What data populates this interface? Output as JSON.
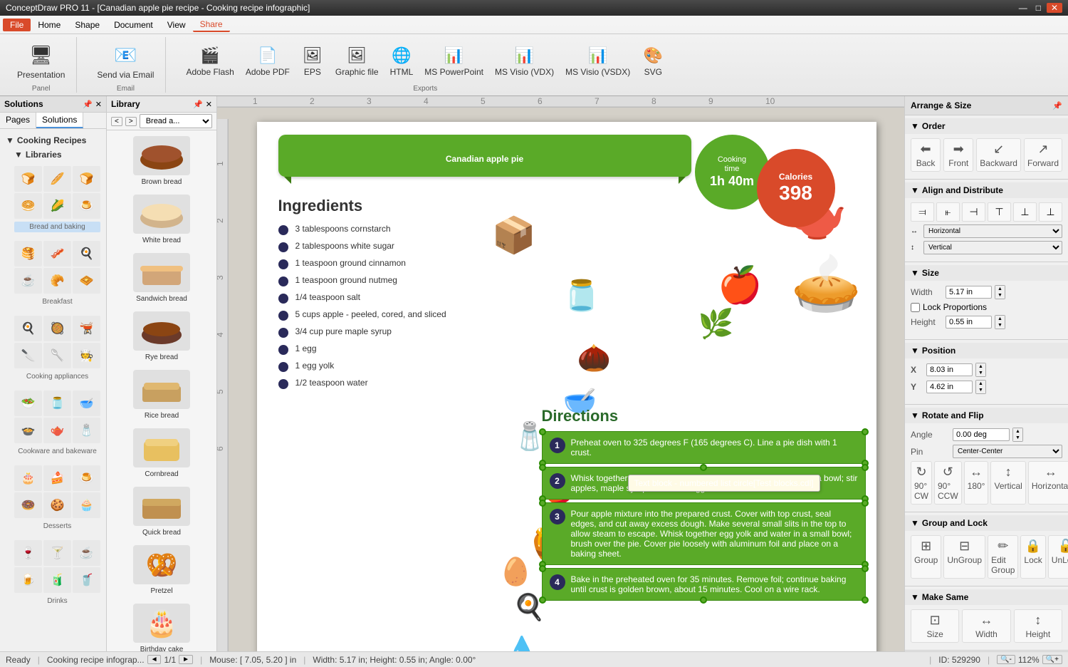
{
  "titlebar": {
    "title": "ConceptDraw PRO 11 - [Canadian apple pie recipe - Cooking recipe infographic]",
    "controls": [
      "—",
      "□",
      "✕"
    ]
  },
  "menubar": {
    "items": [
      "File",
      "Home",
      "Shape",
      "Document",
      "View",
      "Share"
    ]
  },
  "ribbon": {
    "groups": [
      {
        "label": "Panel",
        "buttons": [
          {
            "icon": "🖥",
            "label": "Presentation"
          }
        ]
      },
      {
        "label": "Email",
        "buttons": [
          {
            "icon": "📧",
            "label": "Send via\nEmail"
          }
        ]
      },
      {
        "label": "Exports",
        "buttons": [
          {
            "icon": "🎬",
            "label": "Adobe\nFlash"
          },
          {
            "icon": "📄",
            "label": "Adobe\nPDF"
          },
          {
            "icon": "🖼",
            "label": "EPS"
          },
          {
            "icon": "🖼",
            "label": "Graphic\nfile"
          },
          {
            "icon": "🌐",
            "label": "HTML"
          },
          {
            "icon": "📊",
            "label": "MS\nPowerPoint"
          },
          {
            "icon": "📊",
            "label": "MS Visio\n(VDX)"
          },
          {
            "icon": "📊",
            "label": "MS Visio\n(VSDX)"
          },
          {
            "icon": "🎨",
            "label": "SVG"
          }
        ]
      }
    ]
  },
  "solutions": {
    "title": "Solutions",
    "tabs": [
      "Pages",
      "Solutions"
    ],
    "sections": [
      {
        "name": "Cooking Recipes",
        "subsections": [
          {
            "name": "Libraries",
            "items": [
              "Bread and baking",
              "Breakfast",
              "Cooking appliances",
              "Cookware and bakeware",
              "Desserts",
              "Drinks"
            ]
          }
        ]
      }
    ]
  },
  "library": {
    "title": "Library",
    "nav": [
      "<",
      ">"
    ],
    "dropdown": "Bread a...",
    "items": [
      {
        "emoji": "🍞",
        "label": "Brown bread"
      },
      {
        "emoji": "🥖",
        "label": "White bread"
      },
      {
        "emoji": "🍞",
        "label": "Sandwich bread"
      },
      {
        "emoji": "🥯",
        "label": "Rye bread"
      },
      {
        "emoji": "🌽",
        "label": "Rice bread"
      },
      {
        "emoji": "🍮",
        "label": "Cornbread"
      },
      {
        "emoji": "🥨",
        "label": "Quick bread"
      },
      {
        "emoji": "🥨",
        "label": "Pretzel"
      },
      {
        "emoji": "🎂",
        "label": "Birthday cake"
      }
    ]
  },
  "canvas": {
    "title": "Canadian apple pie",
    "cooking_time": {
      "label": "Cooking\ntime",
      "value": "1h 40m"
    },
    "calories": {
      "label": "Calories",
      "value": "398"
    },
    "ingredients": {
      "title": "Ingredients",
      "items": [
        "3 tablespoons cornstarch",
        "2 tablespoons white sugar",
        "1 teaspoon ground cinnamon",
        "1 teaspoon ground nutmeg",
        "1/4 teaspoon salt",
        "5 cups apple - peeled, cored, and sliced",
        "3/4 cup pure maple syrup",
        "1 egg",
        "1 egg yolk",
        "1/2 teaspoon water"
      ]
    },
    "directions": {
      "title": "Directions",
      "items": [
        "Preheat oven to 325 degrees F (165 degrees C). Line a pie dish with 1 crust.",
        "Whisk together cornstarch, sugar, cinnamon, nutmeg, and salt in a bowl; stir apples, maple syrup and whole egg into the mixture.",
        "Pour apple mixture into the prepared crust. Cover with top crust, seal edges, and cut away excess dough. Make several small slits in the top to allow steam to escape. Whisk together egg yolk and water in a small bowl; brush over the pie. Cover pie loosely with aluminum foil and place on a baking sheet.",
        "Bake in the preheated oven for 35 minutes. Remove foil; continue baking until crust is golden brown, about 15 minutes. Cool on a wire rack."
      ]
    }
  },
  "arrange_size": {
    "title": "Arrange & Size",
    "order": {
      "label": "Order",
      "buttons": [
        "Back",
        "Front",
        "Backward",
        "Forward"
      ]
    },
    "align": {
      "label": "Align and Distribute",
      "buttons": [
        "Left",
        "Center",
        "Right",
        "Top",
        "Middle",
        "Bottom"
      ],
      "h_label": "Horizontal",
      "v_label": "Vertical"
    },
    "size": {
      "label": "Size",
      "width": {
        "label": "Width",
        "value": "5.17 in"
      },
      "height": {
        "label": "Height",
        "value": "0.55 in"
      },
      "lock": "Lock Proportions"
    },
    "position": {
      "label": "Position",
      "x": {
        "label": "X",
        "value": "8.03 in"
      },
      "y": {
        "label": "Y",
        "value": "4.62 in"
      }
    },
    "rotate": {
      "label": "Rotate and Flip",
      "angle": {
        "label": "Angle",
        "value": "0.00 deg"
      },
      "pin": {
        "label": "Pin",
        "value": "Center-Center"
      },
      "buttons": [
        "90° CW",
        "90° CCW",
        "180°",
        "Flip\nVertical",
        "Flip\nHorizontal"
      ]
    },
    "group": {
      "label": "Group and Lock",
      "buttons": [
        "Group",
        "UnGroup",
        "Edit\nGroup",
        "Lock",
        "UnLock"
      ]
    },
    "make_same": {
      "label": "Make Same",
      "buttons": [
        "Size",
        "Width",
        "Height"
      ]
    }
  },
  "statusbar": {
    "left": "Cooking recipe infograp...",
    "page": "1/1",
    "mouse": "Mouse: [ 7.05, 5.20 ] in",
    "dimensions": "Width: 5.17 in; Height: 0.55 in; Angle: 0.00°",
    "id": "ID: 529290",
    "zoom": "112%",
    "status": "Ready"
  },
  "tooltip": {
    "text": "Text block - numbered list circle[Test blocks.cdl]"
  }
}
